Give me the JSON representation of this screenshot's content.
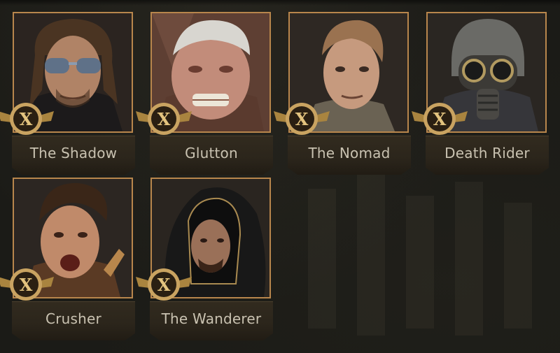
{
  "heroes": [
    {
      "name": "The Shadow",
      "rank": "X",
      "portrait": "man-with-sunglasses-portrait",
      "accent": "#b8864c"
    },
    {
      "name": "Glutton",
      "rank": "X",
      "portrait": "grey-haired-brute-portrait",
      "accent": "#b8864c"
    },
    {
      "name": "The Nomad",
      "rank": "X",
      "portrait": "blond-man-portrait",
      "accent": "#b8864c"
    },
    {
      "name": "Death Rider",
      "rank": "X",
      "portrait": "gas-mask-soldier-portrait",
      "accent": "#b8864c"
    },
    {
      "name": "Crusher",
      "rank": "X",
      "portrait": "shouting-man-portrait",
      "accent": "#b8864c"
    },
    {
      "name": "The Wanderer",
      "rank": "X",
      "portrait": "hooded-man-portrait",
      "accent": "#b8864c"
    }
  ],
  "colors": {
    "background": "#1b1b17",
    "frame": "#b8864c",
    "badge_gold": "#c9a361",
    "badge_dark": "#2a1f12",
    "name_text": "#c9c2b1"
  }
}
